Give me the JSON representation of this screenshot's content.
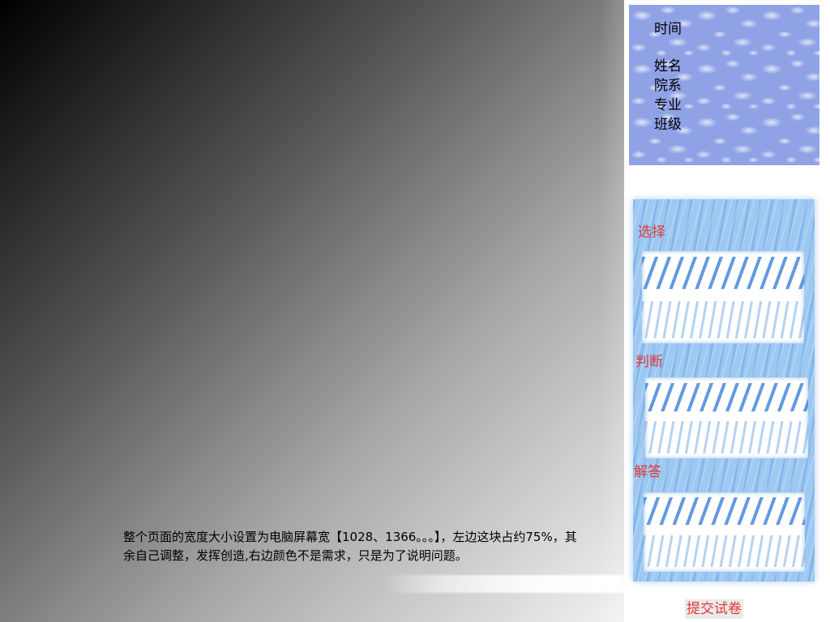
{
  "left": {
    "note": "整个页面的宽度大小设置为电脑屏幕宽【1028、1366。。。】，左边这块占约75%，其余自己调整，发挥创造,右边颜色不是需求，只是为了说明问题。"
  },
  "info": {
    "time_label": "时间",
    "name_label": "姓名",
    "department_label": "院系",
    "major_label": "专业",
    "class_label": "班级"
  },
  "questions": {
    "choice_label": "选择",
    "judge_label": "判断",
    "answer_label": "解答"
  },
  "submit_label": "提交试卷",
  "colors": {
    "label_red": "#e03838",
    "info_bg": "#8fa2e6",
    "panel_bg": "#9cc8f2"
  }
}
